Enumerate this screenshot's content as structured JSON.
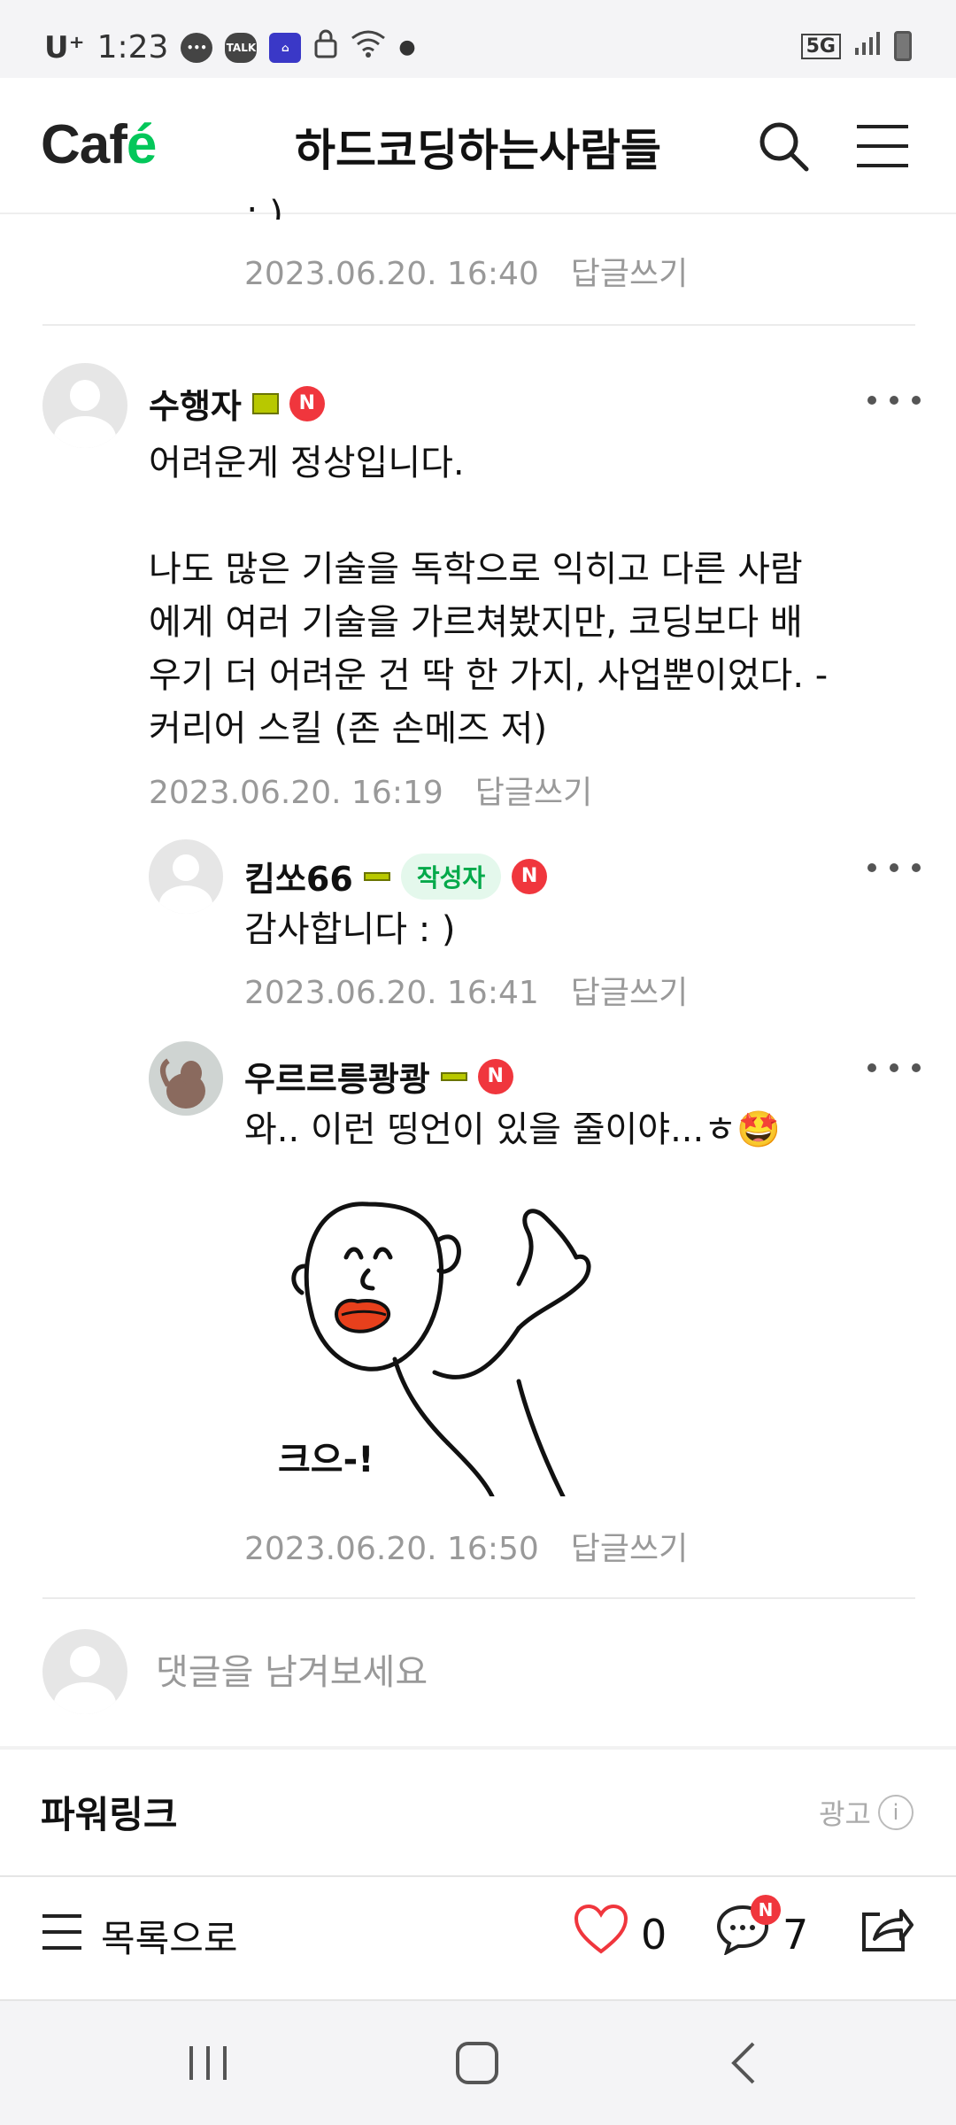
{
  "status_bar": {
    "carrier": "U⁺",
    "time": "1:23",
    "icons": [
      "chat-bubble-icon",
      "kakao-talk-icon",
      "home-app-icon",
      "lock-icon",
      "wifi-icon"
    ],
    "network": "5G"
  },
  "header": {
    "logo_text": "Caf",
    "logo_accent": "é",
    "cafe_name": "하드코딩하는사람들",
    "search_icon": "search-icon",
    "menu_icon": "hamburger-menu-icon"
  },
  "prev_comment": {
    "tail_text": ": )",
    "date": "2023.06.20. 16:40",
    "reply_label": "답글쓰기"
  },
  "comments": [
    {
      "nickname": "수행자",
      "new_badge": "N",
      "text": "어려운게 정상입니다.\n\n나도 많은 기술을 독학으로 익히고 다른 사람\n에게 여러 기술을 가르쳐봤지만, 코딩보다 배\n우기 더 어려운 건 딱 한 가지, 사업뿐이었다. -\n커리어 스킬 (존 손메즈 저)",
      "date": "2023.06.20. 16:19",
      "reply_label": "답글쓰기"
    },
    {
      "nickname": "킴쏘66",
      "author_tag": "작성자",
      "new_badge": "N",
      "text": "감사합니다 : )",
      "date": "2023.06.20. 16:41",
      "reply_label": "답글쓰기"
    },
    {
      "nickname": "우르르릉쾅쾅",
      "new_badge": "N",
      "text": "와.. 이런 띵언이 있을 줄이야...ㅎ🤩",
      "sticker_caption": "크으-!",
      "date": "2023.06.20. 16:50",
      "reply_label": "답글쓰기"
    }
  ],
  "comment_input": {
    "placeholder": "댓글을 남겨보세요"
  },
  "powerlink": {
    "title": "파워링크",
    "ad_label": "광고",
    "info_icon": "info-icon"
  },
  "action_bar": {
    "list_label": "목록으로",
    "like_count": "0",
    "comment_count": "7",
    "comment_new_badge": "N",
    "like_color": "#f0363d"
  },
  "colors": {
    "accent_green": "#03c75a",
    "badge_red": "#f0363d",
    "meta_gray": "#999999"
  }
}
